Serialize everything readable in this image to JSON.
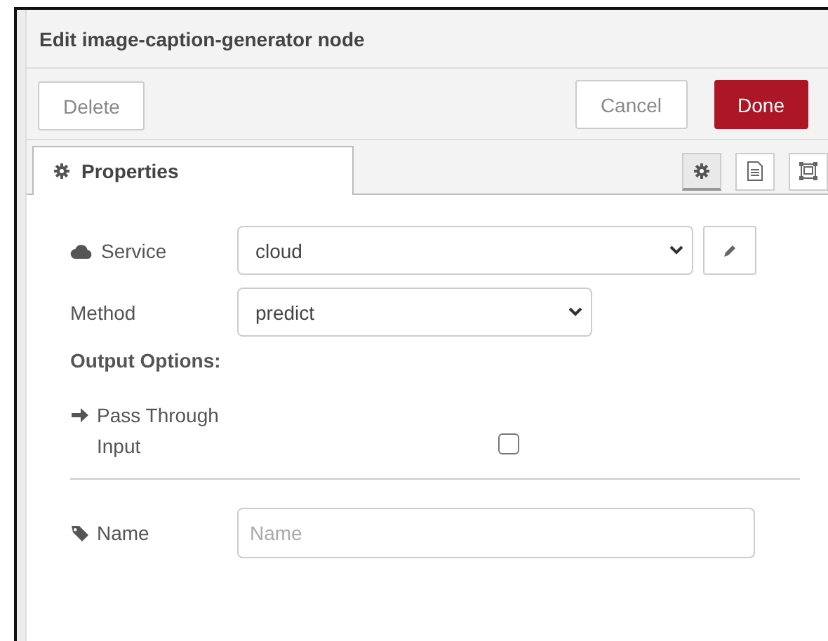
{
  "dialog": {
    "title": "Edit image-caption-generator node"
  },
  "buttons": [
    {
      "label": "Delete",
      "kind": "plain"
    },
    {
      "label": "Cancel",
      "kind": "plain"
    },
    {
      "label": "Done",
      "kind": "primary"
    }
  ],
  "tabs": [
    {
      "label": "Properties",
      "selected": true
    }
  ],
  "side_tabs": [
    {
      "kind": "settings",
      "selected": true
    },
    {
      "kind": "description",
      "selected": false
    },
    {
      "kind": "appearance",
      "selected": false
    }
  ],
  "rows": [
    {
      "kind": "select",
      "label": "Service",
      "value": "cloud",
      "wide": true,
      "edit_button": true
    },
    {
      "kind": "select",
      "label": "Method",
      "value": "predict",
      "wide": false,
      "edit_button": false
    },
    {
      "kind": "heading",
      "label": "Output Options:"
    },
    {
      "kind": "checkbox",
      "label": "Pass Through Input",
      "checked": false
    },
    {
      "kind": "divider"
    },
    {
      "kind": "text",
      "label": "Name",
      "placeholder": "Name"
    }
  ]
}
